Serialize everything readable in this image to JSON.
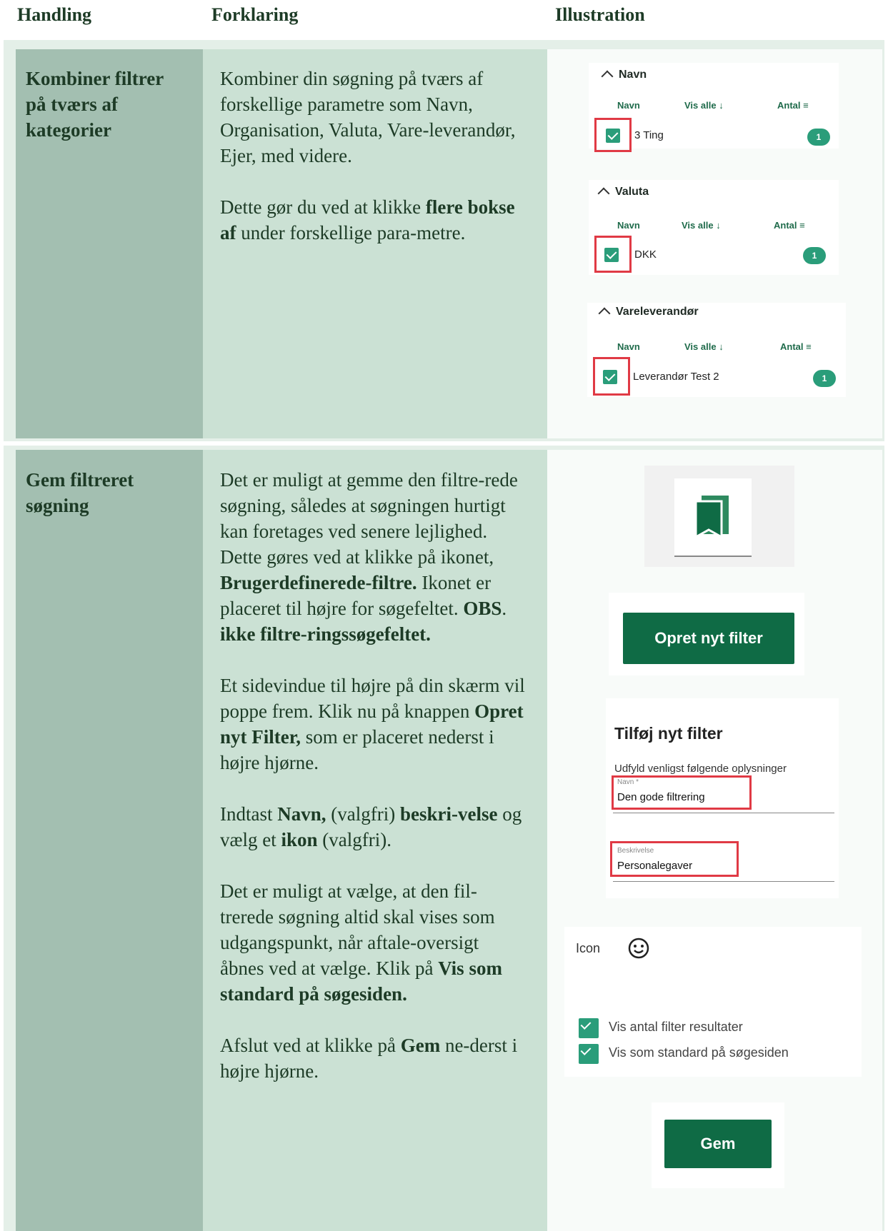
{
  "headers": {
    "action": "Handling",
    "explanation": "Forklaring",
    "illustration": "Illustration"
  },
  "row1": {
    "action": [
      "Kombiner filtrer",
      "på tværs af",
      "kategorier"
    ],
    "p1": "Kombiner din søgning på tværs af forskellige parametre som Navn, Organisation, Valuta, Vare-leverandør, Ejer, med videre.",
    "p2_pre": "Dette gør du ved at klikke ",
    "p2_bold": "flere bokse af",
    "p2_post": " under forskellige para-metre.",
    "filters": [
      {
        "title": "Navn",
        "col_name": "Navn",
        "col_all": "Vis alle",
        "col_count": "Antal",
        "item": "3 Ting",
        "count": "1"
      },
      {
        "title": "Valuta",
        "col_name": "Navn",
        "col_all": "Vis alle",
        "col_count": "Antal",
        "item": "DKK",
        "count": "1"
      },
      {
        "title": "Vareleverandør",
        "col_name": "Navn",
        "col_all": "Vis alle",
        "col_count": "Antal",
        "item": "Leverandør Test 2",
        "count": "1"
      }
    ]
  },
  "row2": {
    "action": [
      "Gem filtreret",
      "søgning"
    ],
    "p1_a": "Det er muligt at gemme den filtre-rede søgning, således at søgningen hurtigt kan foretages ved senere lejlighed. Dette gøres ved at klikke på ikonet, ",
    "p1_b": "Brugerdefinerede-filtre.",
    "p1_c": " Ikonet er placeret til højre for søgefeltet. ",
    "p1_d": "OBS",
    "p1_e": ". ",
    "p1_f": "ikke filtre-ringssøgefeltet.",
    "p2_a": "Et sidevindue til højre på din skærm vil poppe frem. Klik nu på knappen ",
    "p2_b": "Opret nyt Filter,",
    "p2_c": " som er placeret nederst i højre hjørne.",
    "p3_a": "Indtast ",
    "p3_b": "Navn,",
    "p3_c": " (valgfri) ",
    "p3_d": "beskri-velse",
    "p3_e": " og vælg et ",
    "p3_f": "ikon",
    "p3_g": " (valgfri).",
    "p4_a": "Det er muligt at vælge, at den fil-trerede søgning altid skal vises som udgangspunkt, når aftale-oversigt åbnes ved at vælge. Klik på ",
    "p4_b": "Vis som standard på søgesiden.",
    "p5_a": "Afslut ved at klikke på ",
    "p5_b": "Gem",
    "p5_c": " ne-derst i højre hjørne.",
    "ui": {
      "create_btn": "Opret nyt filter",
      "dialog_title": "Tilføj nyt filter",
      "dialog_sub": "Udfyld venligst følgende oplysninger",
      "name_label": "Navn *",
      "name_value": "Den gode filtrering",
      "desc_label": "Beskrivelse",
      "desc_value": "Personalegaver",
      "icon_label": "Icon",
      "check1": "Vis antal filter resultater",
      "check2": "Vis som standard på søgesiden",
      "save_btn": "Gem"
    }
  }
}
